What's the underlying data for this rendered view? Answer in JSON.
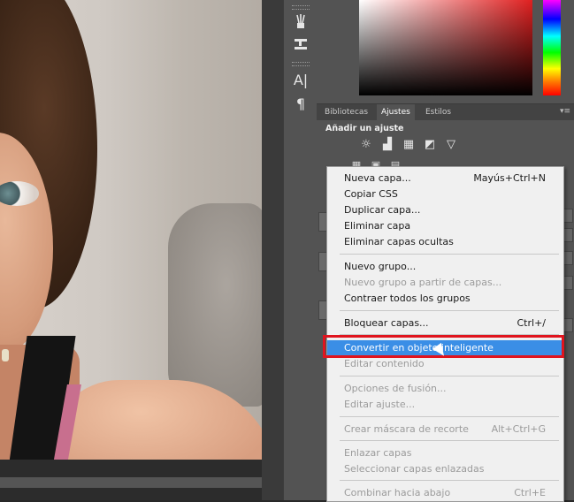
{
  "tools": {
    "icons": [
      "brush-preset-icon",
      "brush-settings-icon",
      "character-icon",
      "paragraph-icon"
    ],
    "text_icon": "A|",
    "paragraph_icon": "¶"
  },
  "panel": {
    "tabs": [
      "Bibliotecas",
      "Ajustes",
      "Estilos"
    ],
    "active_tab": "Ajustes",
    "section_title": "Añadir un ajuste",
    "colors": {
      "picker_hue": "#e02020",
      "menu_highlight": "#3a8ee6",
      "annotation_box": "#e0141e"
    }
  },
  "menu": {
    "items": [
      {
        "label": "Nueva capa...",
        "shortcut": "Mayús+Ctrl+N",
        "enabled": true
      },
      {
        "label": "Copiar CSS",
        "shortcut": "",
        "enabled": true
      },
      {
        "label": "Duplicar capa...",
        "shortcut": "",
        "enabled": true
      },
      {
        "label": "Eliminar capa",
        "shortcut": "",
        "enabled": true
      },
      {
        "label": "Eliminar capas ocultas",
        "shortcut": "",
        "enabled": true
      },
      {
        "label": "Nuevo grupo...",
        "shortcut": "",
        "enabled": true
      },
      {
        "label": "Nuevo grupo a partir de capas...",
        "shortcut": "",
        "enabled": false
      },
      {
        "label": "Contraer todos los grupos",
        "shortcut": "",
        "enabled": true
      },
      {
        "label": "Bloquear capas...",
        "shortcut": "Ctrl+/",
        "enabled": true
      },
      {
        "label": "Convertir en objeto inteligente",
        "shortcut": "",
        "enabled": true,
        "highlighted": true
      },
      {
        "label": "Editar contenido",
        "shortcut": "",
        "enabled": false
      },
      {
        "label": "Opciones de fusión...",
        "shortcut": "",
        "enabled": false
      },
      {
        "label": "Editar ajuste...",
        "shortcut": "",
        "enabled": false
      },
      {
        "label": "Crear máscara de recorte",
        "shortcut": "Alt+Ctrl+G",
        "enabled": false
      },
      {
        "label": "Enlazar capas",
        "shortcut": "",
        "enabled": false
      },
      {
        "label": "Seleccionar capas enlazadas",
        "shortcut": "",
        "enabled": false
      },
      {
        "label": "Combinar hacia abajo",
        "shortcut": "Ctrl+E",
        "enabled": false
      }
    ]
  }
}
